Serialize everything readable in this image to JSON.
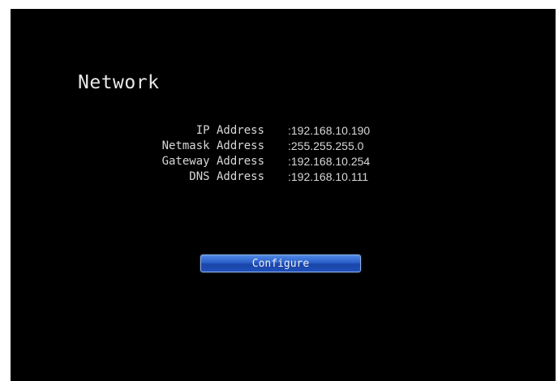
{
  "screen": {
    "title": "Network",
    "network_info": [
      {
        "label": "IP Address",
        "value": ":192.168.10.190"
      },
      {
        "label": "Netmask Address",
        "value": ":255.255.255.0"
      },
      {
        "label": "Gateway Address",
        "value": ":192.168.10.254"
      },
      {
        "label": "DNS Address",
        "value": ":192.168.10.111"
      }
    ],
    "configure_label": "Configure"
  },
  "colors": {
    "background": "#000000",
    "text": "#d8d8d8",
    "button": "#2a5fc8"
  }
}
